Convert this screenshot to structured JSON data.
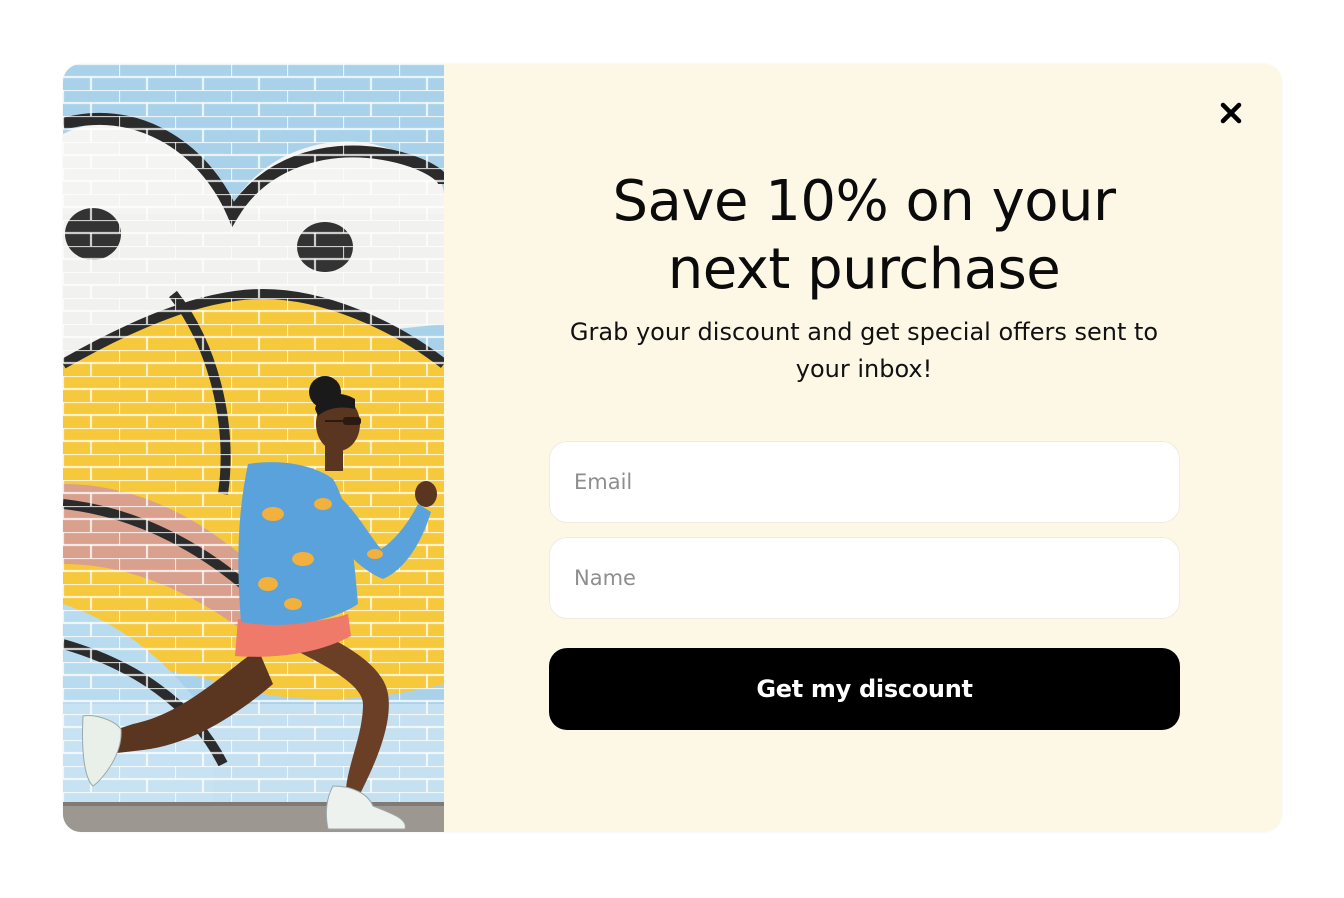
{
  "popup": {
    "image_description": "",
    "close_icon": "close-icon",
    "heading": "Save 10% on your next purchase",
    "subtext": "Grab your discount and get special offers sent to your inbox!",
    "email_placeholder": "Email",
    "email_value": "",
    "name_placeholder": "Name",
    "name_value": "",
    "cta_label": "Get my discount"
  },
  "colors": {
    "content_bg": "#fdf7e6",
    "cta_bg": "#000000",
    "cta_text": "#ffffff",
    "heading": "#0b0b0b"
  }
}
